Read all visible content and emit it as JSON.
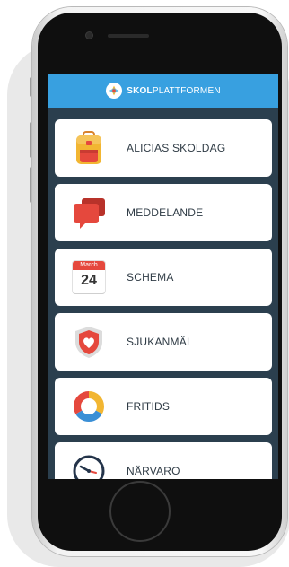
{
  "header": {
    "brand_bold": "SKOL",
    "brand_rest": "PLATTFORMEN"
  },
  "menu": [
    {
      "label": "ALICIAS SKOLDAG",
      "icon": "backpack-icon"
    },
    {
      "label": "MEDDELANDE",
      "icon": "chat-bubbles-icon"
    },
    {
      "label": "SCHEMA",
      "icon": "calendar-icon"
    },
    {
      "label": "SJUKANMÄL",
      "icon": "heart-shield-icon"
    },
    {
      "label": "FRITIDS",
      "icon": "activity-ring-icon"
    },
    {
      "label": "NÄRVARO",
      "icon": "clock-icon"
    }
  ],
  "calendar": {
    "month": "March",
    "day": "24"
  },
  "colors": {
    "header": "#38a0e0",
    "screen_background": "#2b3f4e",
    "tile": "#ffffff",
    "label_text": "#2f3b45"
  }
}
